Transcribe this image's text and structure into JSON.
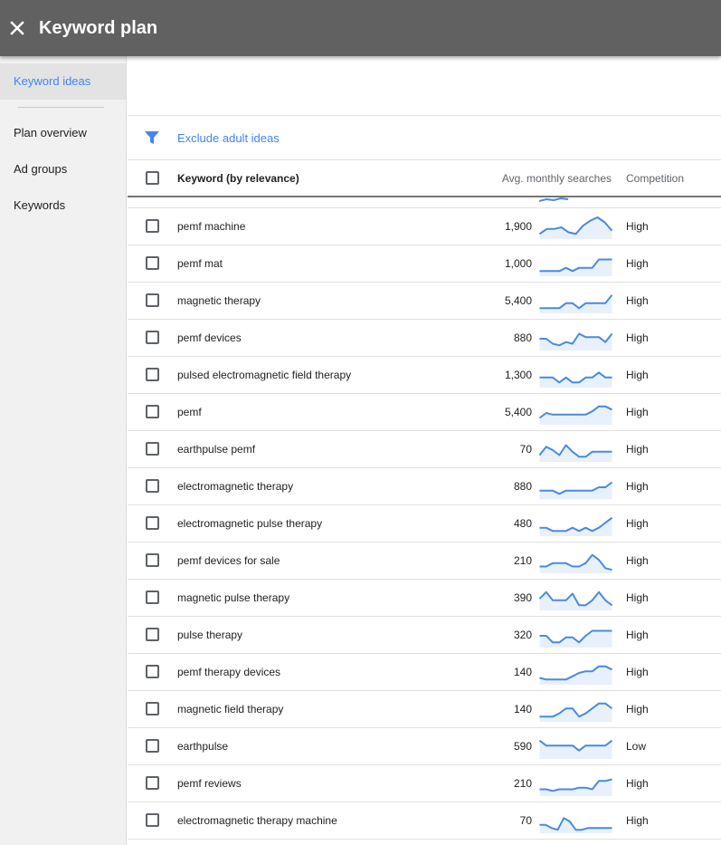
{
  "header": {
    "title": "Keyword plan",
    "close_icon": "close-icon"
  },
  "sidebar": {
    "items": [
      {
        "label": "Keyword ideas",
        "active": true
      },
      {
        "label": "Plan overview",
        "active": false
      },
      {
        "label": "Ad groups",
        "active": false
      },
      {
        "label": "Keywords",
        "active": false
      }
    ]
  },
  "filter": {
    "icon": "filter-icon",
    "label": "Exclude adult ideas"
  },
  "table": {
    "columns": {
      "keyword": "Keyword (by relevance)",
      "searches": "Avg. monthly searches",
      "competition": "Competition"
    },
    "rows": [
      {
        "keyword": "pemf machine",
        "searches": "1,900",
        "trend": [
          2,
          5,
          5,
          6,
          3,
          2,
          7,
          10,
          12,
          9,
          4
        ],
        "competition": "High"
      },
      {
        "keyword": "pemf mat",
        "searches": "1,000",
        "trend": [
          2,
          2,
          2,
          2,
          4,
          2,
          4,
          4,
          4,
          9,
          9,
          9
        ],
        "competition": "High"
      },
      {
        "keyword": "magnetic therapy",
        "searches": "5,400",
        "trend": [
          2,
          2,
          2,
          2,
          5,
          5,
          2,
          5,
          5,
          5,
          5,
          10
        ],
        "competition": "High"
      },
      {
        "keyword": "pemf devices",
        "searches": "880",
        "trend": [
          6,
          6,
          3,
          2,
          4,
          3,
          9,
          7,
          7,
          7,
          4,
          9
        ],
        "competition": "High"
      },
      {
        "keyword": "pulsed electromagnetic field therapy",
        "searches": "1,300",
        "trend": [
          5,
          5,
          5,
          2,
          5,
          2,
          2,
          5,
          5,
          8,
          5,
          5
        ],
        "competition": "High"
      },
      {
        "keyword": "pemf",
        "searches": "5,400",
        "trend": [
          3,
          6,
          5,
          5,
          5,
          5,
          5,
          5,
          7,
          10,
          10,
          8
        ],
        "competition": "High"
      },
      {
        "keyword": "earthpulse pemf",
        "searches": "70",
        "trend": [
          3,
          8,
          6,
          3,
          9,
          5,
          2,
          2,
          5,
          5,
          5,
          5
        ],
        "competition": "High"
      },
      {
        "keyword": "electromagnetic therapy",
        "searches": "880",
        "trend": [
          4,
          4,
          4,
          2,
          4,
          4,
          4,
          4,
          4,
          6,
          6,
          9
        ],
        "competition": "High"
      },
      {
        "keyword": "electromagnetic pulse therapy",
        "searches": "480",
        "trend": [
          4,
          4,
          2,
          2,
          2,
          4,
          2,
          4,
          2,
          4,
          7,
          10
        ],
        "competition": "High"
      },
      {
        "keyword": "pemf devices for sale",
        "searches": "210",
        "trend": [
          3,
          3,
          5,
          5,
          5,
          3,
          3,
          5,
          10,
          7,
          2,
          1
        ],
        "competition": "High"
      },
      {
        "keyword": "magnetic pulse therapy",
        "searches": "390",
        "trend": [
          6,
          10,
          5,
          5,
          5,
          9,
          2,
          2,
          5,
          10,
          5,
          2
        ],
        "competition": "High"
      },
      {
        "keyword": "pulse therapy",
        "searches": "320",
        "trend": [
          6,
          6,
          2,
          2,
          5,
          5,
          2,
          6,
          9,
          9,
          9,
          9
        ],
        "competition": "High"
      },
      {
        "keyword": "pemf therapy devices",
        "searches": "140",
        "trend": [
          3,
          2,
          2,
          2,
          2,
          4,
          6,
          7,
          7,
          10,
          10,
          8
        ],
        "competition": "High"
      },
      {
        "keyword": "magnetic field therapy",
        "searches": "140",
        "trend": [
          2,
          2,
          2,
          4,
          7,
          7,
          2,
          4,
          7,
          10,
          10,
          7
        ],
        "competition": "High"
      },
      {
        "keyword": "earthpulse",
        "searches": "590",
        "trend": [
          10,
          7,
          7,
          7,
          7,
          7,
          4,
          7,
          7,
          7,
          7,
          10
        ],
        "competition": "Low"
      },
      {
        "keyword": "pemf reviews",
        "searches": "210",
        "trend": [
          3,
          3,
          2,
          3,
          3,
          3,
          4,
          4,
          3,
          8,
          8,
          9
        ],
        "competition": "High"
      },
      {
        "keyword": "electromagnetic therapy machine",
        "searches": "70",
        "trend": [
          4,
          4,
          2,
          1,
          8,
          6,
          1,
          1,
          2,
          2,
          2,
          2,
          2
        ],
        "competition": "High"
      }
    ]
  },
  "colors": {
    "topbar": "#616161",
    "accent": "#4285f4",
    "sparkline": "#4a8ae0",
    "sparkfill": "#e8f0fb"
  }
}
